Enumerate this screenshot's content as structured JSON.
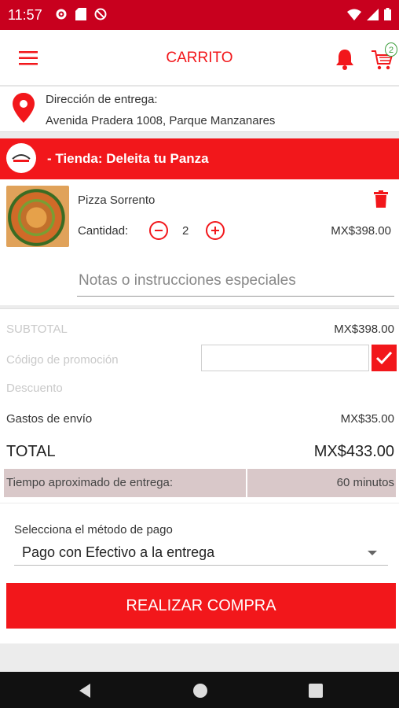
{
  "status_bar": {
    "time": "11:57"
  },
  "header": {
    "title": "CARRITO",
    "cart_count": "2"
  },
  "address": {
    "label": "Dirección de entrega:",
    "value": "Avenida Pradera 1008, Parque Manzanares"
  },
  "store": {
    "name": "-  Tienda: Deleita tu Panza"
  },
  "item": {
    "name": "Pizza Sorrento",
    "quantity_label": "Cantidad:",
    "quantity": "2",
    "price": "MX$398.00"
  },
  "notes": {
    "placeholder": "Notas o instrucciones especiales"
  },
  "summary": {
    "subtotal_label": "SUBTOTAL",
    "subtotal_value": "MX$398.00",
    "promo_label": "Código de promoción",
    "discount_label": "Descuento",
    "shipping_label": "Gastos de envío",
    "shipping_value": "MX$35.00",
    "total_label": "TOTAL",
    "total_value": "MX$433.00",
    "delivery_time_label": "Tiempo aproximado de entrega:",
    "delivery_time_value": "60 minutos"
  },
  "payment": {
    "label": "Selecciona el método de pago",
    "selected": "Pago con Efectivo a la entrega"
  },
  "buy_button": {
    "label": "REALIZAR COMPRA"
  },
  "colors": {
    "primary": "#f2171b",
    "status_bar": "#c8001e",
    "delivery_row": "#d9c8c9"
  },
  "icons": [
    "menu-icon",
    "bell-icon",
    "cart-icon",
    "location-pin-icon",
    "trash-icon",
    "minus-icon",
    "plus-icon",
    "check-icon",
    "back-icon",
    "home-icon",
    "recents-icon"
  ]
}
